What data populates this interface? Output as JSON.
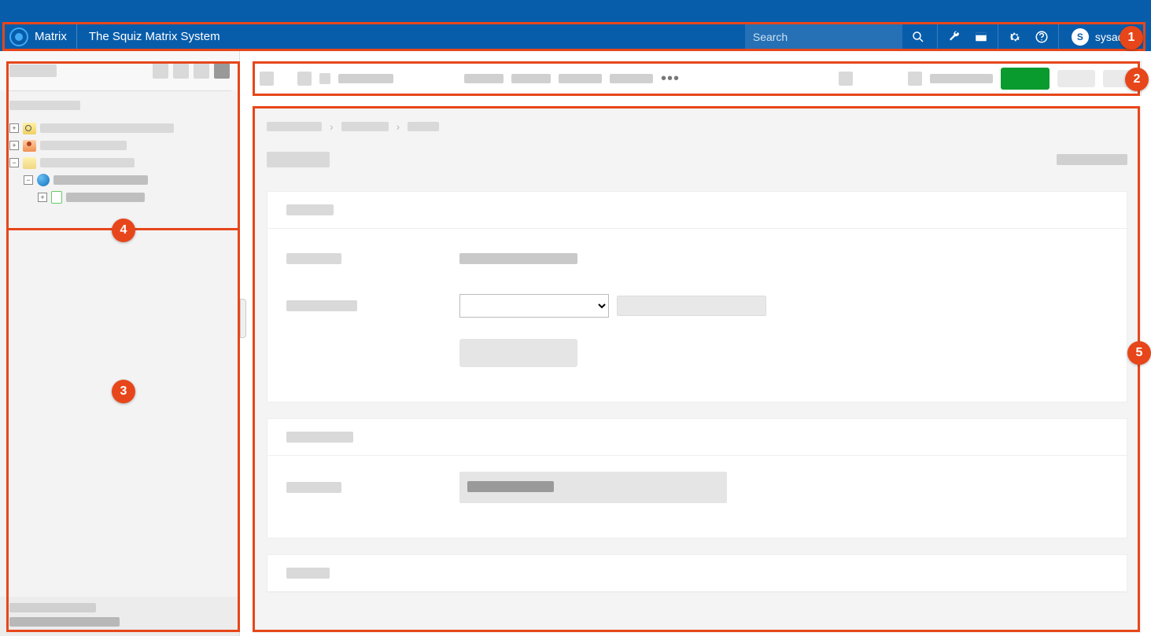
{
  "toolbar": {
    "product_name": "Matrix",
    "system_title": "The Squiz Matrix System",
    "search_placeholder": "Search",
    "user_initial": "S",
    "user_name": "sysadmin"
  },
  "annotations": {
    "badge1": "1",
    "badge2": "2",
    "badge3": "3",
    "badge4": "4",
    "badge5": "5"
  },
  "tree": {
    "expand": "+",
    "collapse": "−"
  }
}
